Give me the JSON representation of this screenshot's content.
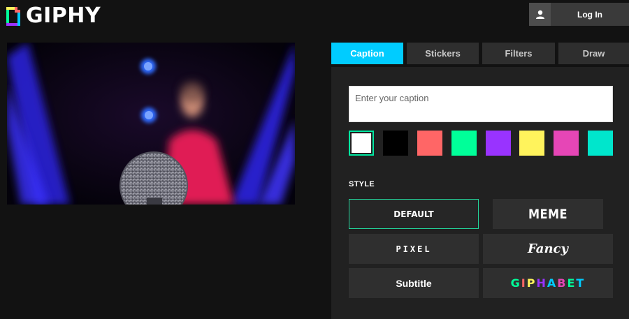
{
  "header": {
    "logo_text": "GIPHY",
    "login_label": "Log In"
  },
  "tabs": [
    {
      "label": "Caption",
      "active": true
    },
    {
      "label": "Stickers",
      "active": false
    },
    {
      "label": "Filters",
      "active": false
    },
    {
      "label": "Draw",
      "active": false
    }
  ],
  "caption": {
    "placeholder": "Enter your caption",
    "value": ""
  },
  "colors": [
    {
      "hex": "#ffffff",
      "selected": true
    },
    {
      "hex": "#000000",
      "selected": false
    },
    {
      "hex": "#ff6666",
      "selected": false
    },
    {
      "hex": "#00ff99",
      "selected": false
    },
    {
      "hex": "#9933ff",
      "selected": false
    },
    {
      "hex": "#fff35c",
      "selected": false
    },
    {
      "hex": "#e646b6",
      "selected": false
    },
    {
      "hex": "#00e6cc",
      "selected": false
    }
  ],
  "style": {
    "label": "STYLE",
    "options": [
      {
        "label": "DEFAULT",
        "active": true
      },
      {
        "label": "MEME",
        "active": false
      },
      {
        "label": "PIXEL",
        "active": false
      },
      {
        "label": "Fancy",
        "active": false
      },
      {
        "label": "Subtitle",
        "active": false
      },
      {
        "label": "GIPHABET",
        "active": false
      }
    ]
  },
  "giphabet_colors": [
    "#00ff99",
    "#ff6666",
    "#fff35c",
    "#9933ff",
    "#00ccff",
    "#e646b6",
    "#00ff99",
    "#00ccff"
  ]
}
